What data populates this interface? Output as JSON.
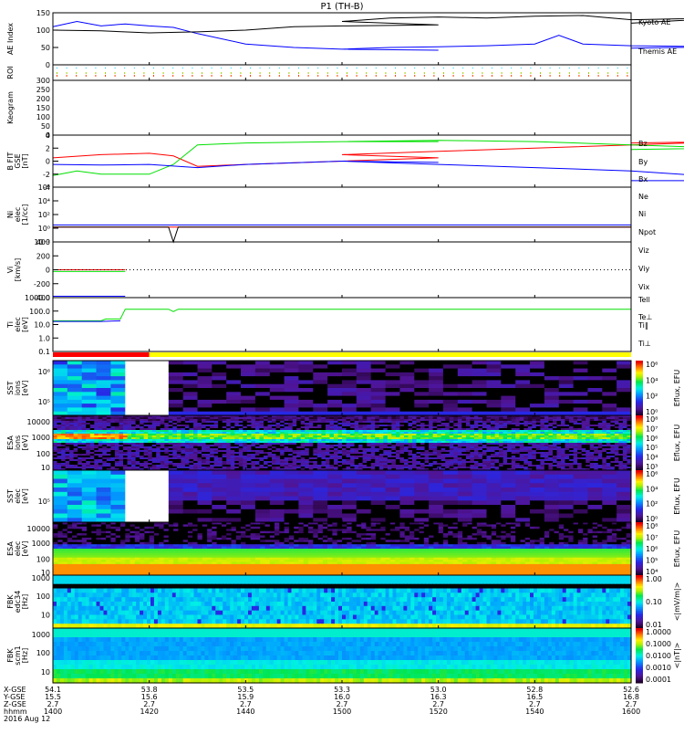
{
  "title": "P1 (TH-B)",
  "colors": {
    "red": "#ff0000",
    "green": "#00e000",
    "blue": "#0000ff",
    "black": "#000000",
    "yellow": "#ffff00"
  },
  "chart_data": [
    {
      "id": "ae",
      "type": "line",
      "ylabel": "AE Index",
      "ylim": [
        0,
        150
      ],
      "yticks": [
        "0",
        "50",
        "100",
        "150"
      ],
      "series": [
        {
          "name": "Kyoto AE",
          "color": "#0000ff",
          "x": [
            1400,
            1405,
            1410,
            1415,
            1420,
            1425,
            1430,
            1440,
            1450,
            1460,
            1480,
            1500,
            1510,
            1520,
            1530,
            1540,
            1545,
            1550,
            1560,
            1580,
            1600
          ],
          "values": [
            110,
            125,
            112,
            118,
            112,
            108,
            90,
            60,
            50,
            45,
            42,
            45,
            50,
            52,
            55,
            60,
            85,
            60,
            55,
            52,
            48
          ]
        },
        {
          "name": "Themis AE",
          "color": "#000000",
          "x": [
            1400,
            1410,
            1420,
            1430,
            1440,
            1450,
            1460,
            1480,
            1500,
            1510,
            1520,
            1530,
            1540,
            1550,
            1560,
            1580,
            1600
          ],
          "values": [
            100,
            98,
            92,
            95,
            100,
            110,
            112,
            115,
            125,
            135,
            138,
            135,
            140,
            142,
            130,
            135,
            120
          ]
        }
      ]
    },
    {
      "id": "roi",
      "type": "line",
      "ylabel": "ROI"
    },
    {
      "id": "keogram",
      "type": "heatmap",
      "ylabel": "Keogram",
      "ylim": [
        0,
        300
      ],
      "yticks": [
        "0",
        "50",
        "100",
        "150",
        "200",
        "250",
        "300"
      ]
    },
    {
      "id": "bfield",
      "type": "line",
      "ylabel": "B FIT\nGSE\n[nT]",
      "ylim": [
        -4,
        4
      ],
      "yticks": [
        "-4",
        "-2",
        "0",
        "2",
        "4"
      ],
      "series": [
        {
          "name": "Bz",
          "color": "#ff0000",
          "x": [
            1400,
            1410,
            1420,
            1425,
            1430,
            1440,
            1460,
            1480,
            1500,
            1520,
            1540,
            1560,
            1580,
            1600
          ],
          "values": [
            0.5,
            1,
            1.2,
            0.8,
            -0.8,
            -0.5,
            0,
            0.5,
            1,
            1.5,
            2,
            2.5,
            3,
            2.8
          ]
        },
        {
          "name": "By",
          "color": "#00e000",
          "x": [
            1400,
            1405,
            1410,
            1420,
            1425,
            1430,
            1440,
            1460,
            1480,
            1500,
            1520,
            1540,
            1560,
            1580,
            1600
          ],
          "values": [
            -2.2,
            -1.5,
            -2,
            -2,
            -0.5,
            2.5,
            2.8,
            3,
            3,
            3,
            3.2,
            3,
            2.5,
            2,
            1.8
          ]
        },
        {
          "name": "Bx",
          "color": "#0000ff",
          "x": [
            1400,
            1410,
            1420,
            1430,
            1440,
            1460,
            1480,
            1500,
            1520,
            1540,
            1560,
            1580,
            1590,
            1600
          ],
          "values": [
            -0.5,
            -0.6,
            -0.5,
            -1,
            -0.5,
            0,
            -0.2,
            0,
            -0.5,
            -1,
            -1.5,
            -2.5,
            -3,
            -3
          ]
        }
      ]
    },
    {
      "id": "density",
      "type": "line",
      "ylabel": "Ni\nelec\n[1/cc]",
      "ylim_log10": [
        -2,
        6
      ],
      "yticks": [
        "10⁻²",
        "10⁰",
        "10²",
        "10⁴",
        "10⁶"
      ],
      "series": [
        {
          "name": "Ne",
          "color": "#ff0000",
          "x": [
            1400,
            1600
          ],
          "values": [
            1.5,
            1.5
          ]
        },
        {
          "name": "Ni",
          "color": "#000000",
          "x": [
            1400,
            1415,
            1424,
            1425,
            1426,
            1428,
            1600
          ],
          "values": [
            1.5,
            1.5,
            1.5,
            0.01,
            1.5,
            1.5,
            1.5
          ]
        },
        {
          "name": "Npot",
          "color": "#0000ff",
          "x": [
            1400,
            1600
          ],
          "values": [
            3,
            3
          ]
        }
      ]
    },
    {
      "id": "velocity",
      "type": "line",
      "ylabel": "Vi\n[km/s]",
      "ylim": [
        -400,
        400
      ],
      "yticks": [
        "-400",
        "-200",
        "0",
        "200",
        "400"
      ],
      "series": [
        {
          "name": "Viz",
          "color": "#ff0000",
          "x": [
            1400,
            1415
          ],
          "values": [
            0,
            0
          ]
        },
        {
          "name": "Viy",
          "color": "#00e000",
          "x": [
            1400,
            1415
          ],
          "values": [
            -25,
            -25
          ]
        },
        {
          "name": "Vix",
          "color": "#0000ff",
          "x": [
            1400,
            1415
          ],
          "values": [
            -380,
            -380
          ]
        }
      ]
    },
    {
      "id": "temperature",
      "type": "line",
      "ylabel": "Ti\nelec\n[eV]",
      "ylim_log10": [
        -1.3,
        3.8
      ],
      "yticks": [
        "0.1",
        "1.0",
        "10.0",
        "100.0",
        "1000.0"
      ],
      "series": [
        {
          "name": "Tell",
          "color": "#000000",
          "x": [],
          "values": []
        },
        {
          "name": "Te⊥",
          "color": "#ff0000",
          "x": [],
          "values": []
        },
        {
          "name": "Ti‖",
          "color": "#00e000",
          "x": [
            1400,
            1410,
            1411,
            1414,
            1415,
            1424,
            1425,
            1426,
            1600
          ],
          "values": [
            40,
            40,
            60,
            60,
            500,
            500,
            300,
            500,
            500
          ]
        },
        {
          "name": "Ti⊥",
          "color": "#0000ff",
          "x": [
            1400,
            1410,
            1414
          ],
          "values": [
            35,
            35,
            40
          ]
        }
      ]
    },
    {
      "id": "sst_ion",
      "type": "heatmap",
      "ylabel": "SST\nions\n[eV]",
      "yticks": [
        "10⁵",
        "10⁶"
      ],
      "colorbar": {
        "label": "Eflux, EFU",
        "ticks": [
          "10⁰",
          "10²",
          "10⁴",
          "10⁶"
        ]
      }
    },
    {
      "id": "esa_ion",
      "type": "heatmap",
      "ylabel": "ESA\nions\n[eV]",
      "yticks": [
        "10",
        "100",
        "1000",
        "10000"
      ],
      "colorbar": {
        "label": "Eflux, EFU",
        "ticks": [
          "10³",
          "10⁴",
          "10⁵",
          "10⁶",
          "10⁷",
          "10⁸"
        ]
      }
    },
    {
      "id": "sst_elec",
      "type": "heatmap",
      "ylabel": "SST\nelec\n[eV]",
      "yticks": [
        "10⁵"
      ],
      "colorbar": {
        "label": "Eflux, EFU",
        "ticks": [
          "10⁰",
          "10²",
          "10⁴",
          "10⁶"
        ]
      }
    },
    {
      "id": "esa_elec",
      "type": "heatmap",
      "ylabel": "ESA\nelec\n[eV]",
      "yticks": [
        "10",
        "100",
        "1000",
        "10000"
      ],
      "colorbar": {
        "label": "Eflux, EFU",
        "ticks": [
          "10⁴",
          "10⁵",
          "10⁶",
          "10⁷",
          "10⁸"
        ]
      }
    },
    {
      "id": "fbk_edc",
      "type": "heatmap",
      "ylabel": "FBK\nedc34\n[Hz]",
      "yticks": [
        "10",
        "100",
        "1000"
      ],
      "colorbar": {
        "label": "<|mV/m|>",
        "ticks": [
          "0.01",
          "0.10",
          "1.00"
        ]
      }
    },
    {
      "id": "fbk_scm",
      "type": "heatmap",
      "ylabel": "FBK\nscm1\n[Hz]",
      "yticks": [
        "10",
        "100",
        "1000"
      ],
      "colorbar": {
        "label": "<|nT|>",
        "ticks": [
          "0.0001",
          "0.0010",
          "0.0100",
          "0.1000",
          "1.0000"
        ]
      }
    }
  ],
  "legends": {
    "ae": [
      "Kyoto AE",
      "Themis AE"
    ],
    "bfield": [
      "Bz",
      "By",
      "Bx"
    ],
    "density": [
      "Ne",
      "Ni",
      "Npot"
    ],
    "velocity": [
      "Viz",
      "Viy",
      "Vix"
    ],
    "temperature": [
      "Tell",
      "Te⊥",
      "Ti‖",
      "Ti⊥"
    ]
  },
  "xaxis": {
    "row_labels": [
      "X-GSE",
      "Y-GSE",
      "Z-GSE",
      "hhmm",
      "2016 Aug 12"
    ],
    "ticks": [
      {
        "x": "54.1",
        "y": "15.5",
        "z": "2.7",
        "t": "1400"
      },
      {
        "x": "53.8",
        "y": "15.6",
        "z": "2.7",
        "t": "1420"
      },
      {
        "x": "53.5",
        "y": "15.9",
        "z": "2.7",
        "t": "1440"
      },
      {
        "x": "53.3",
        "y": "16.0",
        "z": "2.7",
        "t": "1500"
      },
      {
        "x": "53.0",
        "y": "16.3",
        "z": "2.7",
        "t": "1520"
      },
      {
        "x": "52.8",
        "y": "16.5",
        "z": "2.7",
        "t": "1540"
      },
      {
        "x": "52.6",
        "y": "16.8",
        "z": "2.7",
        "t": "1600"
      }
    ]
  }
}
